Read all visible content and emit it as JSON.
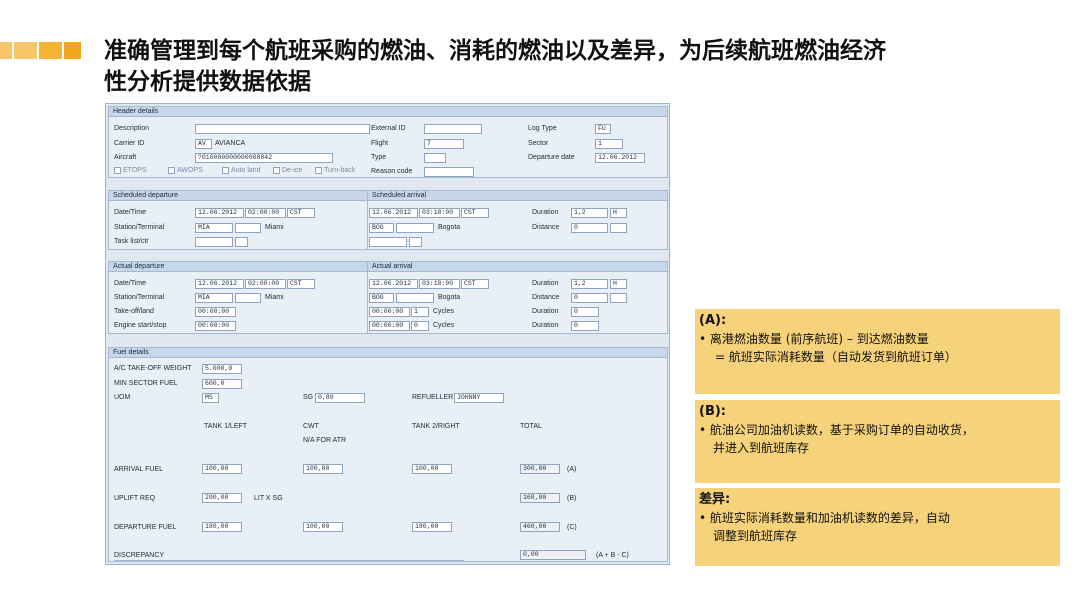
{
  "slide": {
    "title_line1": "准确管理到每个航班采购的燃油、消耗的燃油以及差异，为后续航班燃油经济",
    "title_line2": "性分析提供数据依据"
  },
  "header": {
    "section": "Header details",
    "description_label": "Description",
    "description_value": "",
    "carrier_label": "Carrier ID",
    "carrier_code": "AV",
    "carrier_name": "AVIANCA",
    "aircraft_label": "Aircraft",
    "aircraft_value": "?010000000000008842",
    "external_id_label": "External ID",
    "external_id_value": "",
    "flight_label": "Flight",
    "flight_value": "7",
    "type_label": "Type",
    "type_value": "",
    "reason_label": "Reason code",
    "reason_value": "",
    "log_type_label": "Log Type",
    "log_type_value": "FU",
    "sector_label": "Sector",
    "sector_value": "1",
    "departure_date_label": "Departure date",
    "departure_date_value": "12.06.2012",
    "checkboxes": [
      "ETOPS",
      "AWOPS",
      "Auto land",
      "De-ice",
      "Turn-back"
    ]
  },
  "scheduled_departure": {
    "section": "Scheduled departure",
    "datetime_label": "Date/Time",
    "date": "12.06.2012",
    "time": "02:00:00",
    "tz": "CST",
    "station_label": "Station/Terminal",
    "station": "MIA",
    "terminal": "",
    "city": "Miami",
    "task_label": "Task list/ctr"
  },
  "scheduled_arrival": {
    "section": "Scheduled arrival",
    "date": "12.06.2012",
    "time": "03:10:00",
    "tz": "CST",
    "station": "BOG",
    "city": "Bogota",
    "duration_label": "Duration",
    "duration": "1,2",
    "duration_unit": "H",
    "distance_label": "Distance",
    "distance": "0"
  },
  "actual_departure": {
    "section": "Actual departure",
    "datetime_label": "Date/Time",
    "date": "12.06.2012",
    "time": "02:00:00",
    "tz": "CST",
    "station_label": "Station/Terminal",
    "station": "MIA",
    "city": "Miami",
    "takeoff_label": "Take-off/land",
    "takeoff": "00:00:00",
    "engine_label": "Engine start/stop",
    "engine": "00:00:00"
  },
  "actual_arrival": {
    "section": "Actual arrival",
    "date": "12.06.2012",
    "time": "03:10:00",
    "tz": "CST",
    "station": "BOG",
    "city": "Bogota",
    "land": "00:00:00",
    "land_cycles": "1",
    "engine": "00:00:00",
    "engine_cycles": "0",
    "cycles_label": "Cycles",
    "duration_label": "Duration",
    "duration": "1,2",
    "duration_unit": "H",
    "distance_label": "Distance",
    "distance": "0",
    "duration2": "0",
    "duration3": "0"
  },
  "fuel": {
    "section": "Fuel details",
    "takeoff_weight_label": "A/C TAKE-OFF WEIGHT",
    "takeoff_weight": "5.000,0",
    "min_sector_label": "MIN SECTOR FUEL",
    "min_sector": "600,0",
    "uom_label": "UOM",
    "uom": "MS",
    "sg_label": "SG",
    "sg": "0,80",
    "refueller_label": "REFUELLER",
    "refueller": "JOHNNY",
    "col_tank1": "TANK 1/LEFT",
    "col_cwt": "CWT",
    "col_cwt_note": "N/A FOR ATR",
    "col_tank2": "TANK 2/RIGHT",
    "col_total": "TOTAL",
    "arrival_label": "ARRIVAL FUEL",
    "arrival": [
      "100,00",
      "100,00",
      "100,00",
      "300,00"
    ],
    "arrival_tag": "(A)",
    "uplift_label": "UPLIFT REQ",
    "uplift": "200,00",
    "uplift_unit": "LIT X SG",
    "uplift_total": "160,00",
    "uplift_tag": "(B)",
    "departure_label": "DEPARTURE FUEL",
    "departure": [
      "180,00",
      "100,00",
      "180,00",
      "460,00"
    ],
    "departure_tag": "(C)",
    "discrepancy_label": "DISCREPANCY",
    "discrepancy": "0,00",
    "discrepancy_formula": "(A + B - C)"
  },
  "notes": {
    "a_title": "(A):",
    "a_line1": "• 离港燃油数量 (前序航班) – 到达燃油数量",
    "a_line2": "= 航班实际消耗数量（自动发货到航班订单）",
    "b_title": "(B):",
    "b_line1": "• 航油公司加油机读数，基于采购订单的自动收货，",
    "b_line2": "并进入到航班库存",
    "c_title": "差异:",
    "c_line1": "• 航班实际消耗数量和加油机读数的差异，自动",
    "c_line2": "调整到航班库存"
  },
  "colors": {
    "accent_bar": "#f4b435",
    "note_bg": "#f6d27a",
    "panel_bg": "#dfe7f1"
  }
}
